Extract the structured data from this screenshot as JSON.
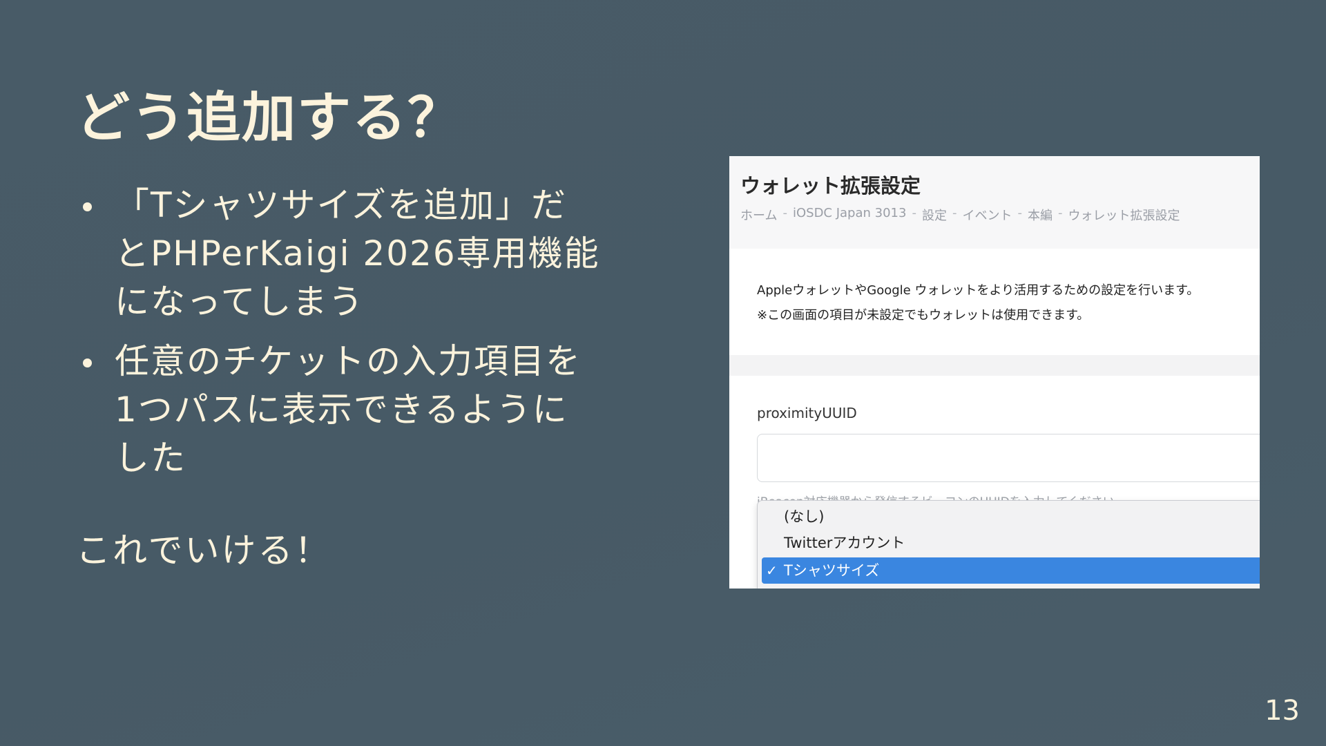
{
  "slide": {
    "title": "どう追加する？",
    "bullets": [
      "「Tシャツサイズを追加」だとPHPerKaigi 2026専用機能になってしまう",
      "任意のチケットの入力項目を1つパスに表示できるようにした"
    ],
    "conclusion": "これでいける！",
    "page_number": "13"
  },
  "screenshot": {
    "page_title": "ウォレット拡張設定",
    "breadcrumb": [
      "ホーム",
      "iOSDC Japan 3013",
      "設定",
      "イベント",
      "本編",
      "ウォレット拡張設定"
    ],
    "breadcrumb_separator": "-",
    "description_line1": "AppleウォレットやGoogle ウォレットをより活用するための設定を行います。",
    "description_line2": "※この画面の項目が未設定でもウォレットは使用できます。",
    "field_label": "proximityUUID",
    "field_value": "",
    "field_hint": "iBeacon対応機器から発信するビーコンのUUIDを入力してください",
    "dropdown_options": [
      "(なし)",
      "Twitterアカウント",
      "Tシャツサイズ"
    ],
    "selected_option": "Tシャツサイズ",
    "check_mark": "✓"
  }
}
